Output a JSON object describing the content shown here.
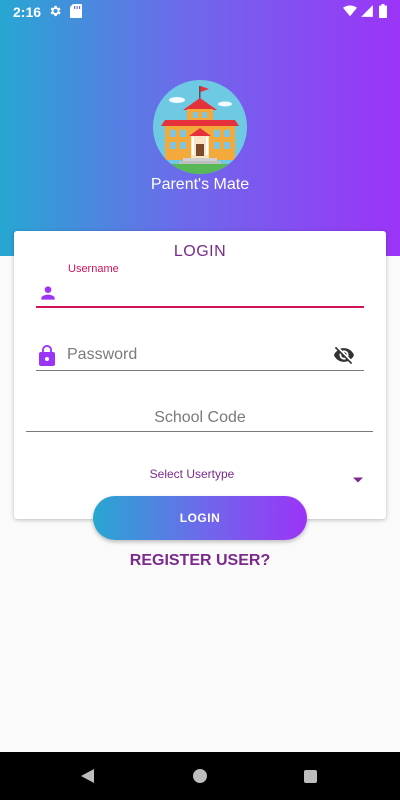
{
  "status_bar": {
    "time": "2:16",
    "icons": [
      "gear-icon",
      "sd-card-icon",
      "wifi-icon",
      "signal-icon",
      "battery-icon"
    ]
  },
  "app": {
    "name": "Parent's Mate",
    "logo": "school-building-icon"
  },
  "login_card": {
    "title": "LOGIN",
    "username": {
      "label": "Username",
      "value": "",
      "icon": "person-icon"
    },
    "password": {
      "placeholder": "Password",
      "value": "",
      "icon": "lock-icon",
      "toggle_icon": "visibility-off-icon"
    },
    "school_code": {
      "placeholder": "School Code",
      "value": ""
    },
    "usertype": {
      "selected": "Select Usertype",
      "icon": "dropdown-arrow-icon"
    }
  },
  "login_button": "LOGIN",
  "register_link": "REGISTER USER?",
  "colors": {
    "gradient_start": "#27a7d2",
    "gradient_end": "#9b34f7",
    "accent": "#d11459",
    "primary_text": "#7b2a8c"
  },
  "nav_bar": {
    "icons": [
      "back-icon",
      "home-icon",
      "recents-icon"
    ]
  }
}
